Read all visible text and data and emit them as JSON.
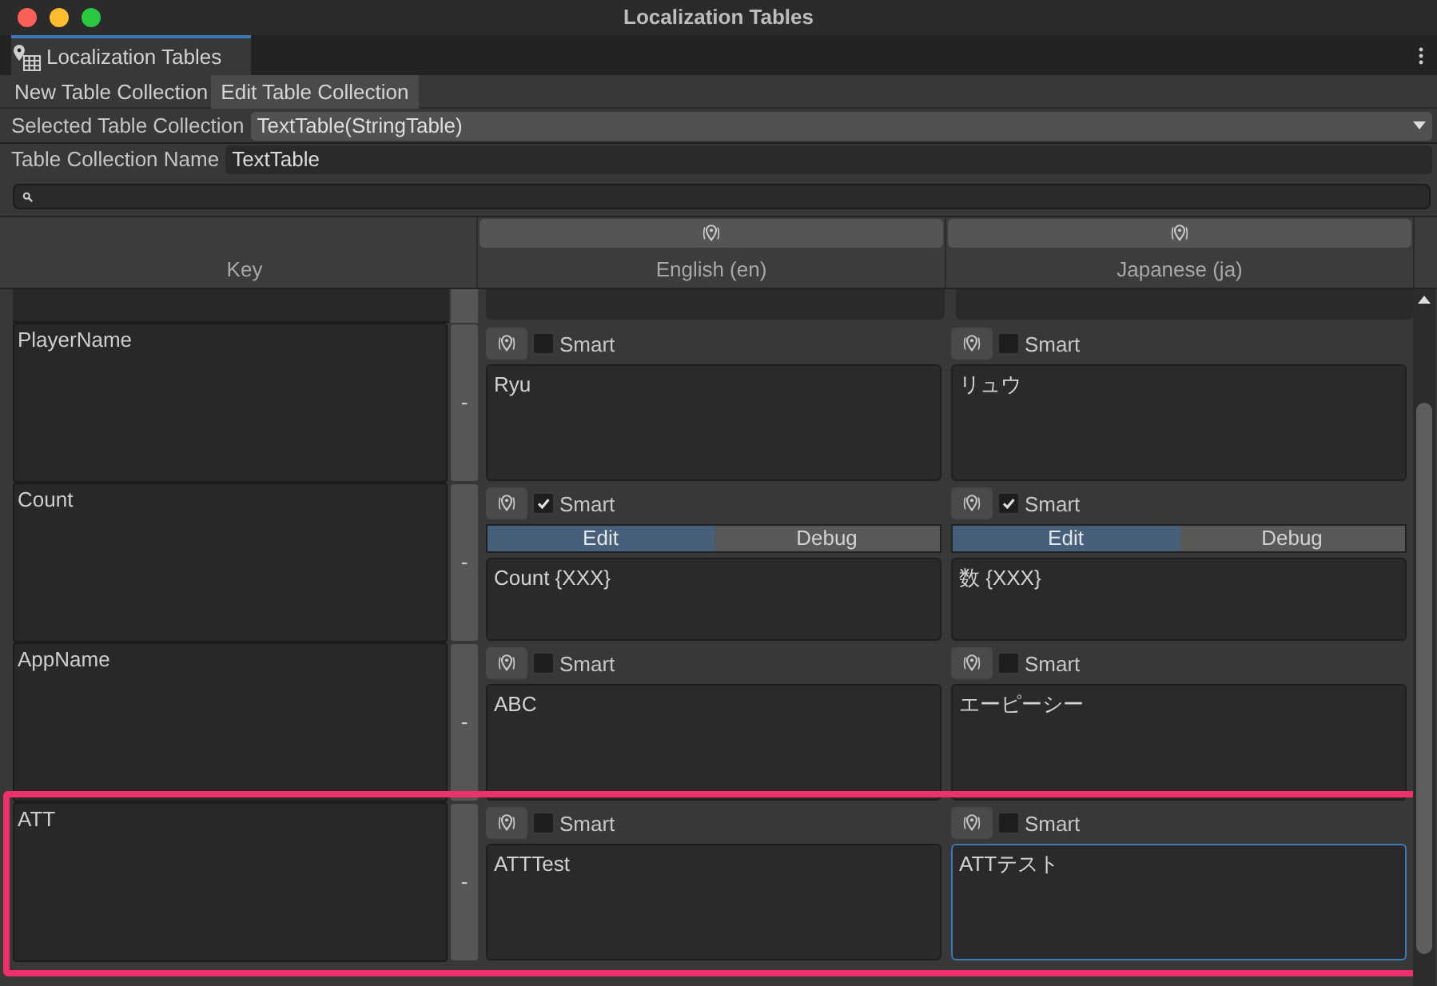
{
  "window": {
    "title": "Localization Tables"
  },
  "panel_tab": {
    "label": "Localization Tables"
  },
  "mode_tabs": [
    {
      "label": "New Table Collection",
      "selected": false
    },
    {
      "label": "Edit Table Collection",
      "selected": true
    }
  ],
  "selected_table_collection": {
    "label": "Selected Table Collection",
    "value": "TextTable(StringTable)"
  },
  "table_collection_name": {
    "label": "Table Collection Name",
    "value": "TextTable"
  },
  "table": {
    "columns": [
      "Key",
      "English (en)",
      "Japanese (ja)"
    ],
    "remove_label": "-",
    "rows": [
      {
        "key": "PlayerName",
        "highlighted": false,
        "cells": [
          {
            "smart": false,
            "smart_label": "Smart",
            "text": "Ryu",
            "focused": false
          },
          {
            "smart": false,
            "smart_label": "Smart",
            "text": "リュウ",
            "focused": false
          }
        ]
      },
      {
        "key": "Count",
        "highlighted": false,
        "cells": [
          {
            "smart": true,
            "smart_label": "Smart",
            "modes": [
              {
                "label": "Edit",
                "selected": true
              },
              {
                "label": "Debug",
                "selected": false
              }
            ],
            "text": "Count {XXX}",
            "focused": false
          },
          {
            "smart": true,
            "smart_label": "Smart",
            "modes": [
              {
                "label": "Edit",
                "selected": true
              },
              {
                "label": "Debug",
                "selected": false
              }
            ],
            "text": "数 {XXX}",
            "focused": false
          }
        ]
      },
      {
        "key": "AppName",
        "highlighted": false,
        "cells": [
          {
            "smart": false,
            "smart_label": "Smart",
            "text": "ABC",
            "focused": false
          },
          {
            "smart": false,
            "smart_label": "Smart",
            "text": "エーピーシー",
            "focused": false
          }
        ]
      },
      {
        "key": "ATT",
        "highlighted": true,
        "cells": [
          {
            "smart": false,
            "smart_label": "Smart",
            "text": "ATTTest",
            "focused": false
          },
          {
            "smart": false,
            "smart_label": "Smart",
            "text": "ATTテスト",
            "focused": true
          }
        ]
      }
    ]
  }
}
